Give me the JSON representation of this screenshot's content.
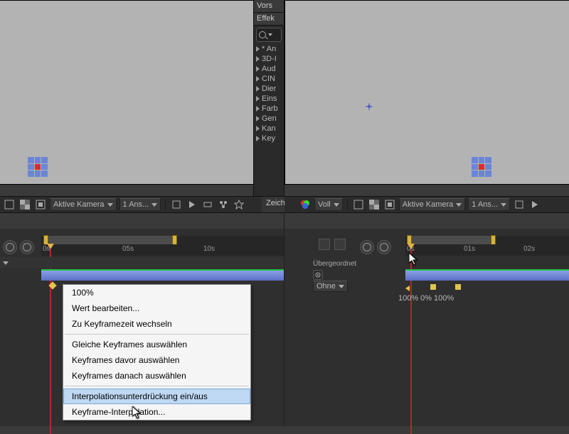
{
  "toolbar_left": {
    "camera_label": "Aktive Kamera",
    "views_label": "1 Ans..."
  },
  "toolbar_right": {
    "mode_label": "Voll",
    "camera_label": "Aktive Kamera",
    "views_label": "1 Ans..."
  },
  "mid_panel": {
    "tab1": "Vors",
    "tab2": "Effek",
    "search_placeholder": "",
    "rows": [
      "* An",
      "3D-I",
      "Aud",
      "CIN",
      "Dier",
      "Eins",
      "Farb",
      "Gen",
      "Kan",
      "Key"
    ]
  },
  "mid_right_tab": "Zeich",
  "timeline_left": {
    "ticks": [
      "0s",
      "05s",
      "10s"
    ],
    "range_start_pct": 1,
    "range_end_pct": 54
  },
  "timeline_right": {
    "parent_label": "Übergeordnet",
    "parent_value": "Ohne",
    "ticks": [
      "0s",
      "01s",
      "02s"
    ],
    "range_start_pct": 1,
    "range_end_pct": 52,
    "keyframe_pct_labels": [
      "100%",
      "0%",
      "100%"
    ]
  },
  "context_menu": {
    "items_top": [
      "100%",
      "Wert bearbeiten...",
      "Zu Keyframezeit wechseln"
    ],
    "items_mid": [
      "Gleiche Keyframes auswählen",
      "Keyframes davor auswählen",
      "Keyframes danach auswählen"
    ],
    "item_selected": "Interpolationsunterdrückung ein/aus",
    "items_bottom": [
      "Keyframe-Interpolation..."
    ]
  }
}
